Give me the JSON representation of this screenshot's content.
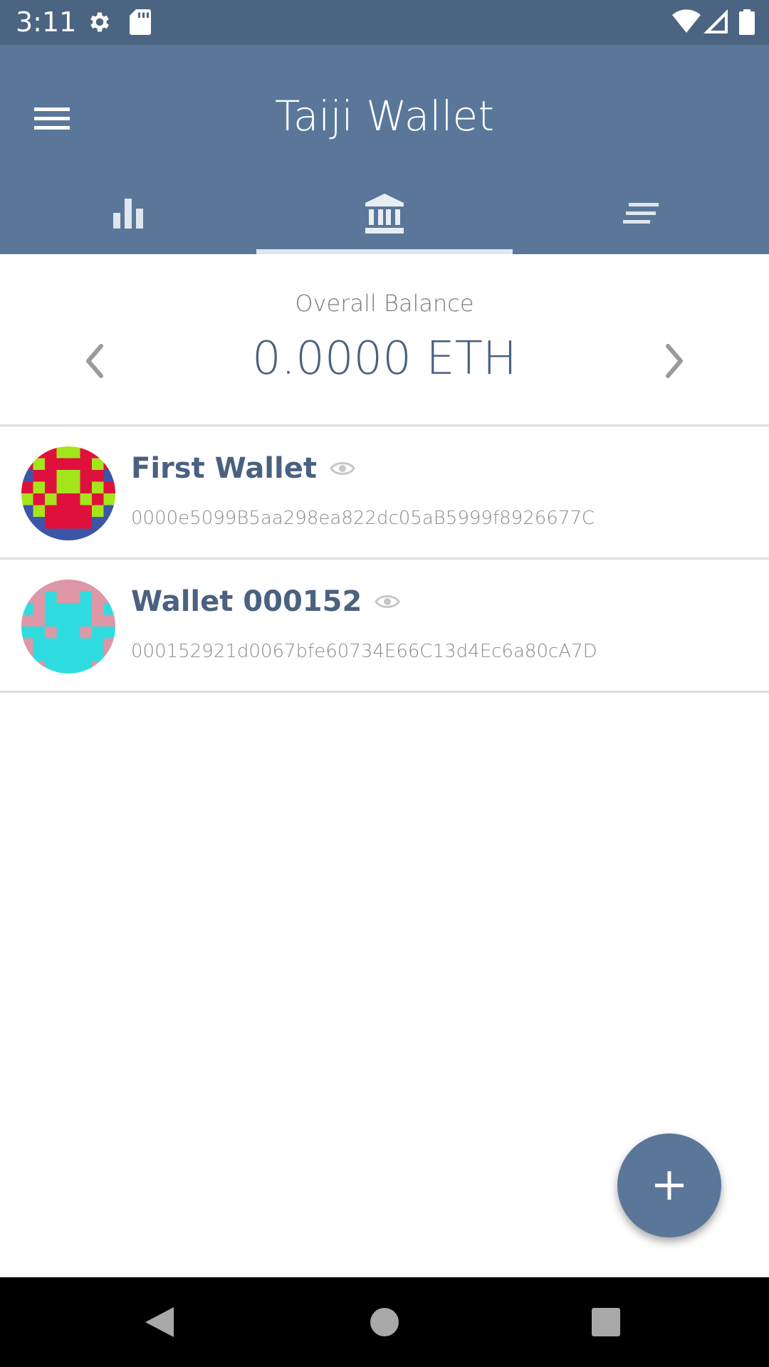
{
  "status_bar": {
    "time": "3:11",
    "icons": [
      "settings-icon",
      "sd-card-icon",
      "wifi-icon",
      "signal-icon",
      "battery-icon"
    ]
  },
  "app_bar": {
    "title": "Taiji Wallet",
    "menu_icon": "hamburger-menu-icon",
    "tabs": [
      {
        "icon": "bar-chart-icon",
        "selected": false
      },
      {
        "icon": "bank-icon",
        "selected": true
      },
      {
        "icon": "list-lines-icon",
        "selected": false
      }
    ]
  },
  "balance": {
    "label": "Overall Balance",
    "value": "0.0000 ETH"
  },
  "wallets": [
    {
      "name": "First Wallet",
      "address": "0000e5099B5aa298ea822dc05aB5999f8926677C",
      "icon": "identicon",
      "watch_icon": "eye-icon"
    },
    {
      "name": "Wallet 000152",
      "address": "000152921d0067bfe60734E66C13d4Ec6a80cA7D",
      "icon": "identicon",
      "watch_icon": "eye-icon"
    }
  ],
  "fab": {
    "icon": "plus-icon"
  },
  "colors": {
    "primary": "#5a7799",
    "status_bar": "#4b6482",
    "text_primary": "#4a6180"
  }
}
